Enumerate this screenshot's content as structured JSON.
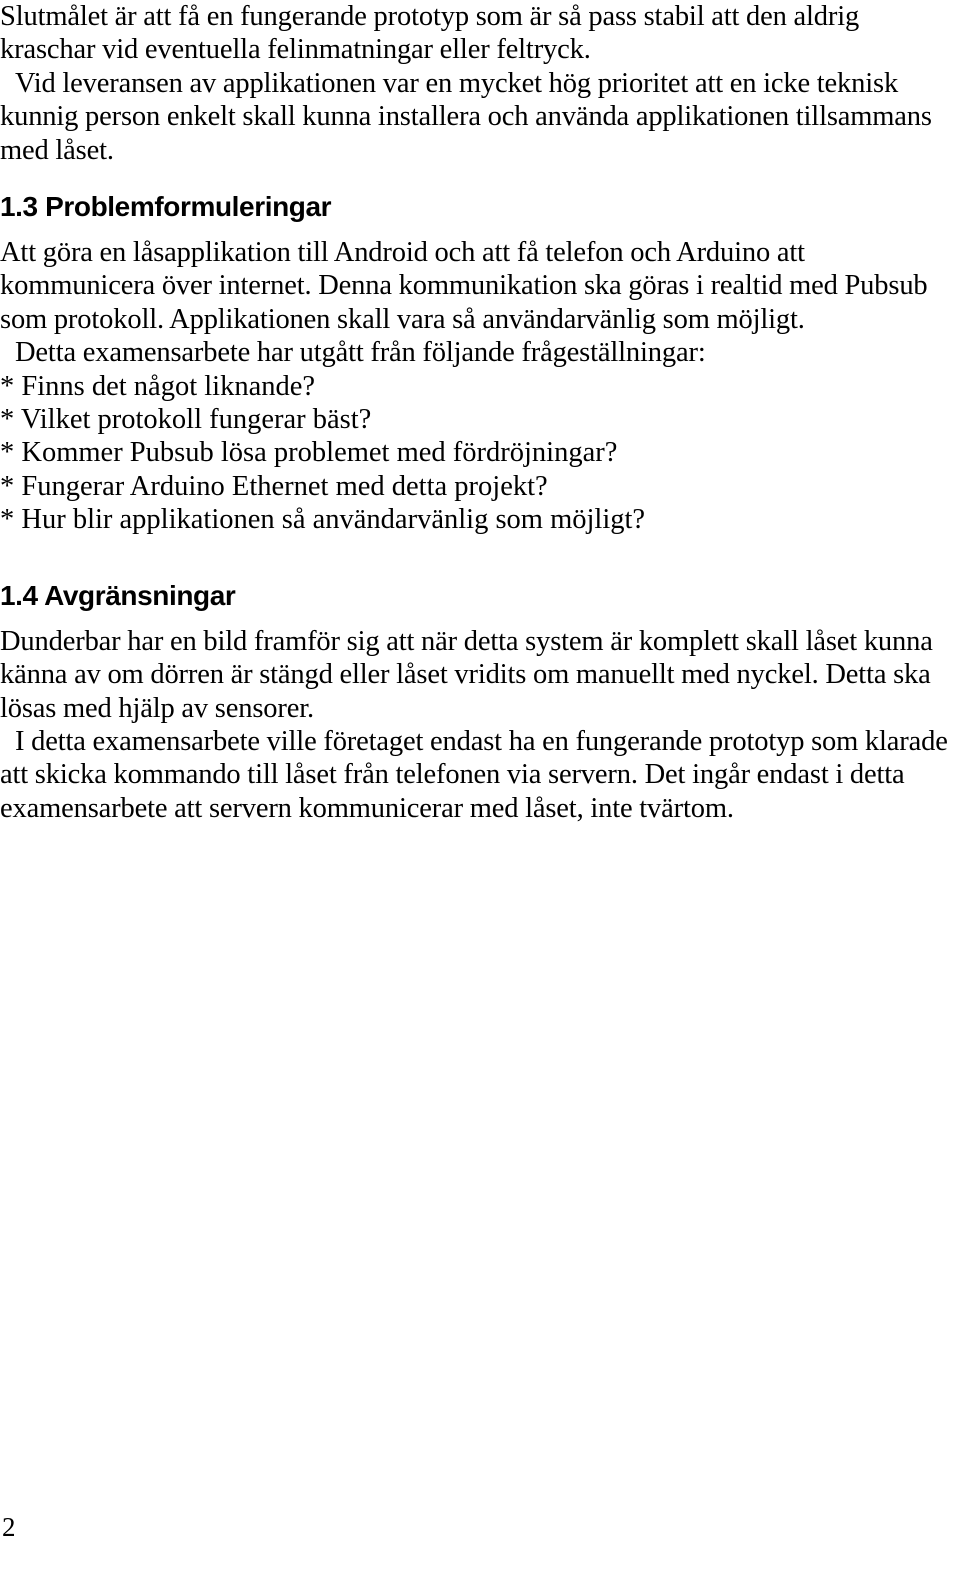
{
  "document": {
    "language": "sv",
    "page_number": "2",
    "text_color": "#000000",
    "background_color": "#ffffff"
  },
  "blocks": [
    {
      "type": "paragraph",
      "id": "intro-paragraph-1",
      "text": "Slutmålet är att få en fungerande prototyp som är så pass stabil att den aldrig kraschar vid eventuella felinmatningar eller feltryck."
    },
    {
      "type": "paragraph",
      "id": "intro-paragraph-2",
      "text": "Vid leveransen av applikationen var en mycket hög prioritet att en icke teknisk kunnig person enkelt skall kunna installera och använda applikationen tillsammans med låset."
    },
    {
      "type": "heading",
      "id": "heading-1-3",
      "text": "1.3 Problemformuleringar"
    },
    {
      "type": "paragraph",
      "id": "problem-paragraph-1",
      "text": "Att göra en låsapplikation till Android och att få telefon och Arduino att kommunicera över internet. Denna kommunikation ska göras i realtid med Pubsub som protokoll. Applikationen skall vara så användarvänlig som möjligt."
    },
    {
      "type": "paragraph",
      "id": "problem-paragraph-2",
      "text": "Detta examensarbete har utgått från följande frågeställningar:"
    },
    {
      "type": "list",
      "id": "research-questions",
      "items": [
        "* Finns det något liknande?",
        "* Vilket protokoll fungerar bäst?",
        "* Kommer Pubsub lösa problemet med fördröjningar?",
        "* Fungerar Arduino Ethernet med detta projekt?",
        "* Hur blir applikationen så användarvänlig som möjligt?"
      ]
    },
    {
      "type": "heading",
      "id": "heading-1-4",
      "text": "1.4 Avgränsningar"
    },
    {
      "type": "paragraph",
      "id": "scope-paragraph-1",
      "text": "Dunderbar har en bild framför sig att när detta system är komplett skall låset kunna känna av om dörren är stängd eller låset vridits om manuellt med nyckel. Detta ska lösas med hjälp av sensorer."
    },
    {
      "type": "paragraph",
      "id": "scope-paragraph-2",
      "text": "I detta examensarbete ville företaget endast ha en fungerande prototyp som klarade att skicka kommando till låset från telefonen via servern. Det ingår endast i detta examensarbete att servern kommunicerar med låset, inte tvärtom."
    }
  ],
  "footer": {
    "page_number": "2"
  }
}
